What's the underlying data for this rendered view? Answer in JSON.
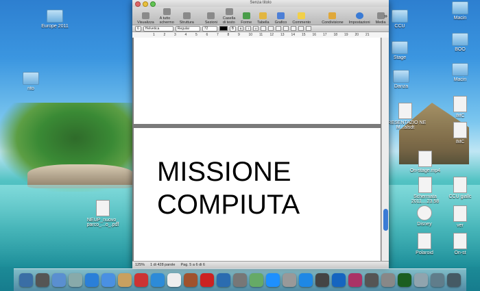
{
  "window": {
    "title": "Senza titolo",
    "toolbar": [
      {
        "label": "Visualizza",
        "name": "toolbar-view-button",
        "icon": "view-icon"
      },
      {
        "label": "A tutto schermo",
        "name": "toolbar-fullscreen-button",
        "icon": "fullscreen-icon"
      },
      {
        "label": "Struttura",
        "name": "toolbar-outline-button",
        "icon": "outline-icon"
      },
      {
        "label": "Sezioni",
        "name": "toolbar-sections-button",
        "icon": "sections-icon"
      },
      {
        "label": "Casella di testo",
        "name": "toolbar-textbox-button",
        "icon": "textbox-icon"
      },
      {
        "label": "Forme",
        "name": "toolbar-shapes-button",
        "icon": "shapes-icon"
      },
      {
        "label": "Tabella",
        "name": "toolbar-table-button",
        "icon": "table-icon"
      },
      {
        "label": "Grafico",
        "name": "toolbar-chart-button",
        "icon": "chart-icon"
      },
      {
        "label": "Commento",
        "name": "toolbar-comment-button",
        "icon": "comment-icon"
      },
      {
        "label": "Condivisione",
        "name": "toolbar-share-button",
        "icon": "share-icon"
      },
      {
        "label": "Impostazioni",
        "name": "toolbar-inspector-button",
        "icon": "info-icon"
      },
      {
        "label": "Media",
        "name": "toolbar-media-button",
        "icon": "media-icon"
      }
    ],
    "more_glyph": "»",
    "format": {
      "style_value": "6",
      "font": "Helvetica",
      "weight": "Regular",
      "size": "72",
      "spacing": "B",
      "bold": "B",
      "italic": "I",
      "underline": "U"
    },
    "ruler_numbers": [
      "1",
      "2",
      "3",
      "4",
      "5",
      "6",
      "7",
      "8",
      "9",
      "10",
      "11",
      "12",
      "13",
      "14",
      "15",
      "16",
      "17",
      "18",
      "19",
      "20",
      "21"
    ],
    "document": {
      "line1": "MISSIONE",
      "line2": "COMPIUTA"
    },
    "status": {
      "zoom": "125%",
      "words": "1 di 428 parole",
      "page": "Pag. 5 a 6 di 6"
    }
  },
  "desktop_icons": [
    {
      "label": "Europe 2011",
      "type": "folder"
    },
    {
      "label": "CCU",
      "type": "folder"
    },
    {
      "label": "Macin",
      "type": "folder"
    },
    {
      "label": "BOO",
      "type": "folder"
    },
    {
      "label": "Stage",
      "type": "folder"
    },
    {
      "label": "nto",
      "type": "folder"
    },
    {
      "label": "Danza",
      "type": "folder"
    },
    {
      "label": "Macin",
      "type": "folder"
    },
    {
      "label": "PRESENTAZIO NE M...alsdt",
      "type": "doc"
    },
    {
      "label": "IMC",
      "type": "doc"
    },
    {
      "label": "On-stage.mp4",
      "type": "doc"
    },
    {
      "label": "IMC",
      "type": "doc"
    },
    {
      "label": "NEUP_nuovo_ parco_...o_.pdf",
      "type": "doc"
    },
    {
      "label": "Schermata 2011....23.58",
      "type": "doc"
    },
    {
      "label": "CCU giallc",
      "type": "doc"
    },
    {
      "label": "Disney",
      "type": "doc"
    },
    {
      "label": "ver",
      "type": "doc"
    },
    {
      "label": "Polaroid",
      "type": "doc"
    },
    {
      "label": "On-st",
      "type": "doc"
    }
  ],
  "dock_colors": [
    "#3a6ea5",
    "#555",
    "#5a8fd0",
    "#8aa",
    "#2a7fd8",
    "#4a90e2",
    "#c8a060",
    "#c33",
    "#2d8bd8",
    "#eee",
    "#a0522d",
    "#c22",
    "#2b6cb0",
    "#777",
    "#6a6",
    "#1e90ff",
    "#999",
    "#1e88e5",
    "#444",
    "#1565c0",
    "#aa3366",
    "#555",
    "#888",
    "#1b5e20",
    "#90a4ae",
    "#607d8b",
    "#455a64"
  ]
}
